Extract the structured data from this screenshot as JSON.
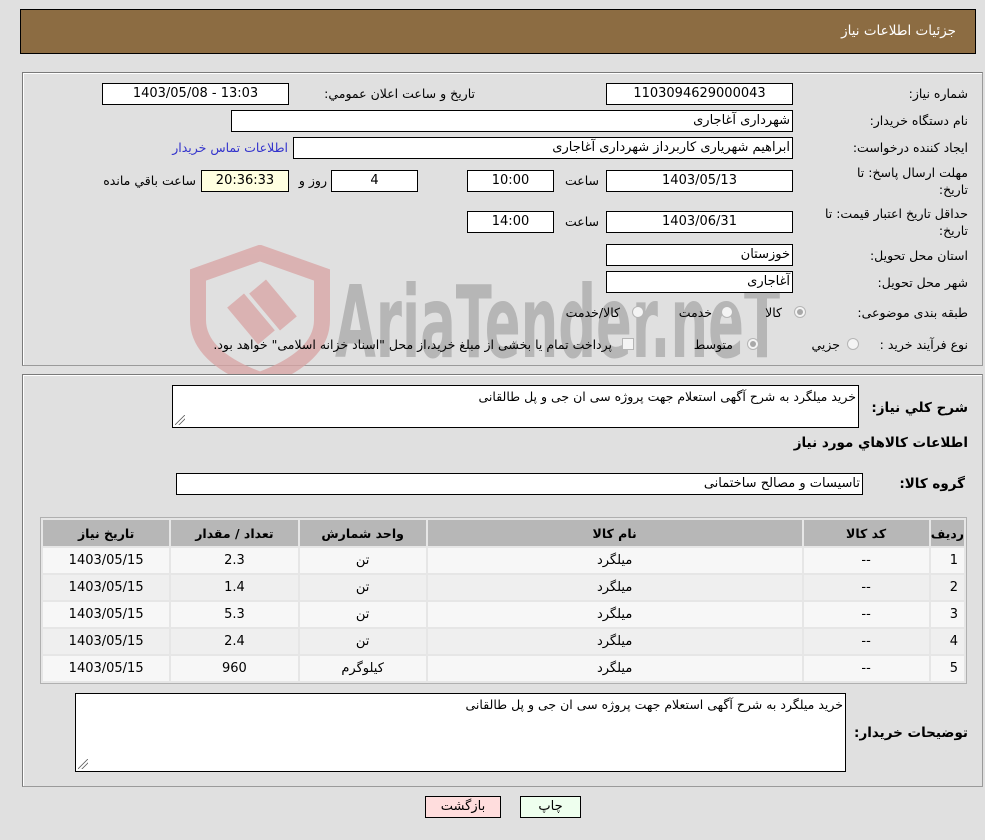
{
  "header": {
    "title": "جزئیات اطلاعات نیاز"
  },
  "details": {
    "need_number": {
      "label": "شماره نیاز:",
      "value": "1103094629000043"
    },
    "announce": {
      "label": "تاريخ و ساعت اعلان عمومي:",
      "value": "1403/05/08 - 13:03"
    },
    "buyer_org": {
      "label": "نام دستگاه خریدار:",
      "value": "شهرداری آغاجاری"
    },
    "creator": {
      "label": "ایجاد کننده درخواست:",
      "value": "ابراهیم شهریاری کاربرداز شهرداری آغاجاری",
      "contact_link": "اطلاعات تماس خریدار"
    },
    "reply_deadline": {
      "label_line1": "مهلت ارسال پاسخ: تا",
      "label_line2": "تاریخ:",
      "date": "1403/05/13",
      "time_label": "ساعت",
      "time": "10:00",
      "days": "4",
      "days_label": "روز و",
      "remaining": "20:36:33",
      "remaining_label": "ساعت باقي مانده"
    },
    "price_validity": {
      "label_line1": "حداقل تاریخ اعتبار قیمت: تا",
      "label_line2": "تاریخ:",
      "date": "1403/06/31",
      "time_label": "ساعت",
      "time": "14:00"
    },
    "province": {
      "label": "استان محل تحویل:",
      "value": "خوزستان"
    },
    "city": {
      "label": "شهر محل تحویل:",
      "value": "آغاجاری"
    },
    "category": {
      "label": "طبقه بندی موضوعی:",
      "options": [
        {
          "label": "کالا",
          "selected": true
        },
        {
          "label": "خدمت",
          "selected": false
        },
        {
          "label": "کالا/خدمت",
          "selected": false
        }
      ]
    },
    "process_type": {
      "label": "نوع فرآیند خرید :",
      "options": [
        {
          "label": "جزیي",
          "selected": false
        },
        {
          "label": "متوسط",
          "selected": true
        }
      ],
      "treasury_checkbox_checked": false,
      "treasury_text": "پرداخت تمام یا بخشی از مبلغ خرید،از محل \"اسناد خزانه اسلامی\" خواهد بود."
    }
  },
  "description": {
    "label": "شرح کلي نياز:",
    "value": "خرید میلگرد به شرح آگهی استعلام جهت پروژه سی ان جی و پل طالقانی"
  },
  "goods_section": {
    "title": "اطلاعات کالاهاي مورد نياز",
    "group_label": "گروه کالا:",
    "group_value": "تاسیسات و مصالح ساختمانی",
    "table": {
      "headers": [
        "ردیف",
        "کد کالا",
        "نام کالا",
        "واحد شمارش",
        "تعداد / مقدار",
        "تاریخ نیاز"
      ],
      "rows": [
        [
          "1",
          "--",
          "میلگرد",
          "تن",
          "2.3",
          "1403/05/15"
        ],
        [
          "2",
          "--",
          "میلگرد",
          "تن",
          "1.4",
          "1403/05/15"
        ],
        [
          "3",
          "--",
          "میلگرد",
          "تن",
          "5.3",
          "1403/05/15"
        ],
        [
          "4",
          "--",
          "میلگرد",
          "تن",
          "2.4",
          "1403/05/15"
        ],
        [
          "5",
          "--",
          "میلگرد",
          "کیلوگرم",
          "960",
          "1403/05/15"
        ]
      ]
    }
  },
  "buyer_notes": {
    "label": "توضیحات خریدار:",
    "value": "خرید میلگرد به شرح آگهی استعلام جهت پروژه سی ان جی و پل طالقانی"
  },
  "buttons": {
    "print": "چاپ",
    "back": "بازگشت"
  },
  "watermark": {
    "text": "AriaTender.neT",
    "shield_color": "#d9a3a3",
    "text_color": "#a8a8a8"
  },
  "colors": {
    "header_bg": "#8c6c42",
    "link": "#3333cc",
    "countdown_bg": "#ffffe0",
    "back_btn": "#ffdddd",
    "print_btn": "#eeffee"
  }
}
